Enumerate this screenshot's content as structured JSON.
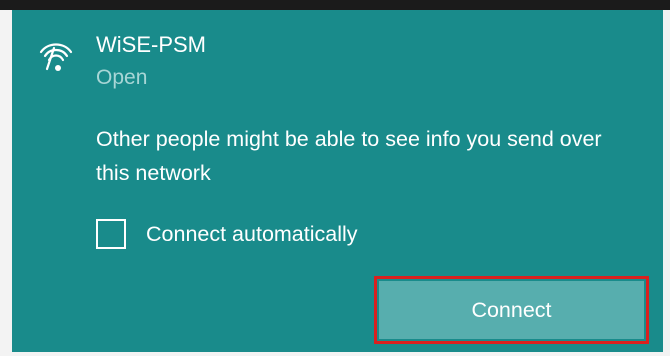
{
  "network": {
    "name": "WiSE-PSM",
    "status": "Open",
    "icon": "wifi-signal-icon"
  },
  "warning": {
    "text": "Other people might be able to see info you send over this network"
  },
  "auto_connect": {
    "label": "Connect automatically",
    "checked": false
  },
  "connect_button": {
    "label": "Connect"
  },
  "colors": {
    "panel_background": "#198b8b",
    "status_text": "#a8d6d6",
    "button_background": "#57aeae",
    "highlight_border": "#d9201f"
  }
}
